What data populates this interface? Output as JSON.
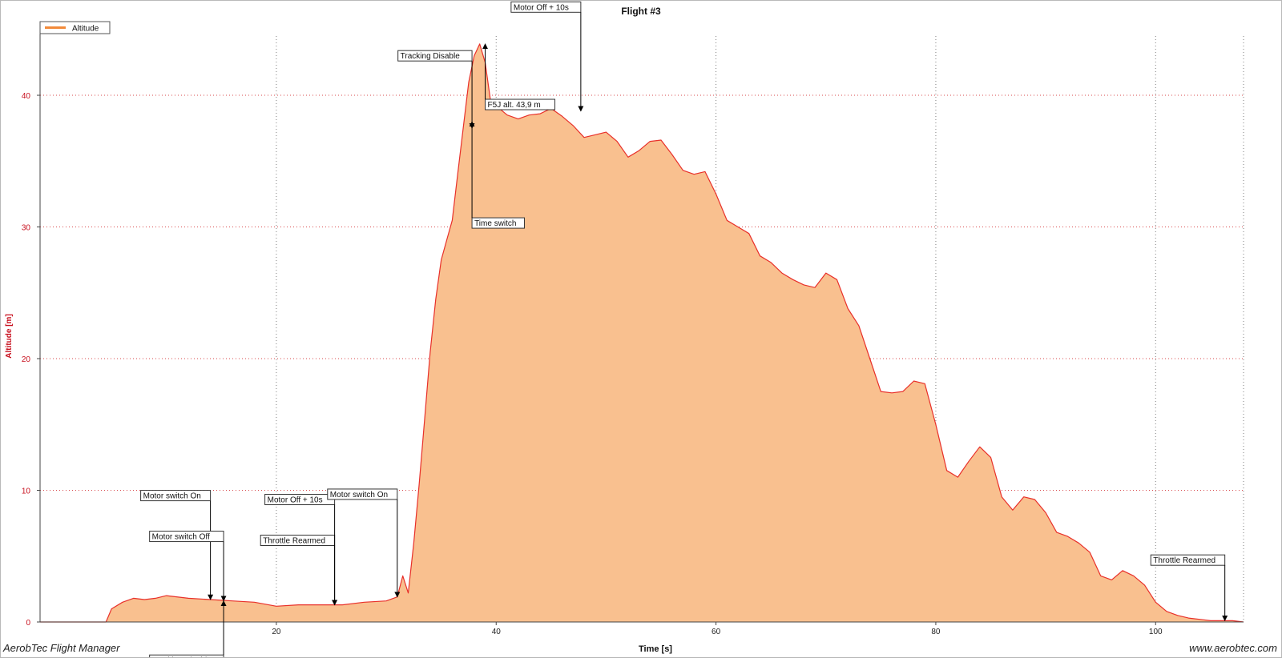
{
  "footer": {
    "app_name": "AerobTec Flight Manager",
    "website": "www.aerobtec.com"
  },
  "colors": {
    "line": "#e8302a",
    "fill": "#f9c08f",
    "grid": "#7f7f7f",
    "grid_red": "#d8484b",
    "axis_text_y": "#c8101e",
    "legend_line": "#f28a3a"
  },
  "chart_data": {
    "type": "area",
    "title": "Flight #3",
    "xlabel": "Time [s]",
    "ylabel": "Altitude [m]",
    "xlim": [
      -1.5,
      108
    ],
    "ylim": [
      0,
      44.5
    ],
    "x_ticks": [
      20,
      40,
      60,
      80,
      100
    ],
    "y_ticks": [
      0,
      10,
      20,
      30,
      40
    ],
    "grid": true,
    "legend": {
      "position": "top-left",
      "entries": [
        "Altitude"
      ]
    },
    "series": [
      {
        "name": "Altitude",
        "x": [
          -1.5,
          4.5,
          5,
          6,
          7,
          8,
          9,
          10,
          12,
          14,
          16,
          18,
          20,
          22,
          24,
          26,
          28,
          30,
          31,
          31.5,
          32,
          32.5,
          33,
          33.5,
          34,
          34.5,
          35,
          35.5,
          36,
          36.5,
          37,
          37.5,
          38,
          38.5,
          39,
          39.5,
          40,
          41,
          42,
          43,
          44,
          45,
          46,
          47,
          48,
          49,
          50,
          51,
          52,
          53,
          54,
          55,
          56,
          57,
          58,
          59,
          60,
          61,
          62,
          63,
          64,
          65,
          66,
          67,
          68,
          69,
          70,
          71,
          72,
          73,
          74,
          75,
          76,
          77,
          78,
          79,
          80,
          81,
          82,
          83,
          84,
          85,
          86,
          87,
          88,
          89,
          90,
          91,
          92,
          93,
          94,
          95,
          96,
          97,
          98,
          99,
          100,
          101,
          102,
          103,
          104,
          105,
          106,
          107,
          108
        ],
        "y": [
          0,
          0,
          1,
          1.5,
          1.8,
          1.7,
          1.8,
          2.0,
          1.8,
          1.7,
          1.6,
          1.5,
          1.2,
          1.3,
          1.3,
          1.3,
          1.5,
          1.6,
          1.9,
          3.5,
          2.2,
          6.0,
          10.5,
          15.5,
          20.5,
          24.5,
          27.5,
          29.0,
          30.5,
          34.0,
          37.5,
          41.0,
          43.0,
          43.9,
          42.5,
          39.5,
          39.2,
          38.5,
          38.2,
          38.5,
          38.6,
          39.0,
          38.4,
          37.7,
          36.8,
          37.0,
          37.2,
          36.5,
          35.3,
          35.8,
          36.5,
          36.6,
          35.5,
          34.3,
          34.0,
          34.2,
          32.5,
          30.5,
          30.0,
          29.5,
          27.8,
          27.3,
          26.5,
          26.0,
          25.6,
          25.4,
          26.5,
          26.0,
          23.8,
          22.5,
          20.0,
          17.5,
          17.4,
          17.5,
          18.3,
          18.1,
          15.0,
          11.5,
          11.0,
          12.2,
          13.3,
          12.5,
          9.5,
          8.5,
          9.5,
          9.3,
          8.3,
          6.8,
          6.5,
          6.0,
          5.3,
          3.5,
          3.2,
          3.9,
          3.5,
          2.8,
          1.5,
          0.8,
          0.5,
          0.3,
          0.2,
          0.1,
          0.1,
          0.1,
          0
        ]
      }
    ],
    "annotations": [
      {
        "text": "Motor switch On",
        "x": 14.0,
        "y": 1.7,
        "direction": "down",
        "label_y": 9.6,
        "box_at": "left"
      },
      {
        "text": "Motor switch Off",
        "x": 15.2,
        "y": 1.6,
        "direction": "down",
        "label_y": 6.5,
        "box_at": "left"
      },
      {
        "text": "Tracking Disable",
        "x": 15.2,
        "y": 1.6,
        "direction": "up",
        "label_y": -2.9,
        "box_at": "left"
      },
      {
        "text": "Throttle Rearmed",
        "x": 25.3,
        "y": 1.3,
        "direction": "down",
        "label_y": 6.2,
        "box_at": "left"
      },
      {
        "text": "Motor Off + 10s",
        "x": 25.3,
        "y": 1.3,
        "direction": "down",
        "label_y": 9.3,
        "box_at": "left"
      },
      {
        "text": "Motor switch On",
        "x": 31.0,
        "y": 1.9,
        "direction": "down",
        "label_y": 9.7,
        "box_at": "left"
      },
      {
        "text": "Tracking Disable",
        "x": 37.8,
        "y": 37.5,
        "direction": "down",
        "label_y": 43.0,
        "box_at": "left"
      },
      {
        "text": "Time switch",
        "x": 37.8,
        "y": 38.0,
        "direction": "up",
        "label_y": 30.3,
        "box_at": "right"
      },
      {
        "text": "F5J alt. 43,9 m",
        "x": 39.0,
        "y": 43.9,
        "direction": "up",
        "label_y": 39.3,
        "box_at": "right"
      },
      {
        "text": "Motor Off + 10s",
        "x": 47.7,
        "y": 38.8,
        "direction": "down",
        "label_y": 46.7,
        "box_at": "left"
      },
      {
        "text": "Throttle Rearmed",
        "x": 106.3,
        "y": 0.1,
        "direction": "down",
        "label_y": 4.7,
        "box_at": "left"
      }
    ]
  }
}
